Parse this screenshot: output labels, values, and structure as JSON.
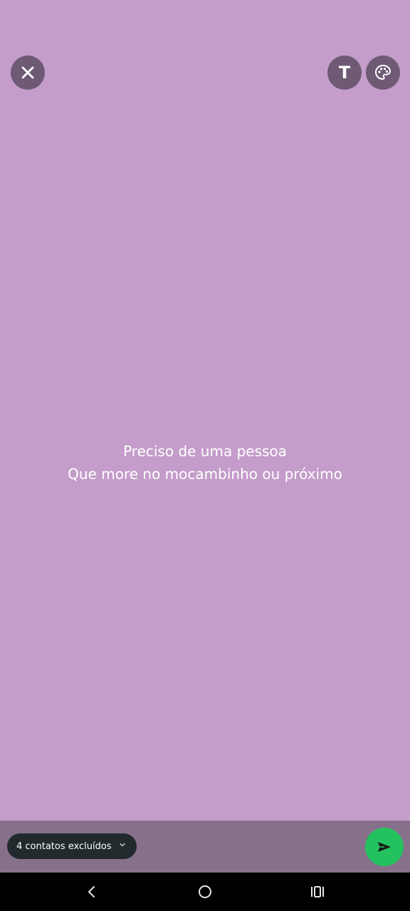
{
  "top_actions": {
    "close_icon": "close-icon",
    "text_style_label": "T",
    "palette_icon": "palette-icon"
  },
  "status": {
    "line1": "Preciso de uma pessoa",
    "line2": "Que more no mocambinho ou próximo"
  },
  "bottom": {
    "audience_label": "4 contatos excluídos",
    "dropdown_icon": "chevron-down-icon",
    "send_icon": "send-icon"
  },
  "nav": {
    "back_icon": "back-icon",
    "home_icon": "home-icon",
    "recents_icon": "recents-icon"
  },
  "colors": {
    "background": "#c49dca",
    "bottom_bar": "#86708a",
    "button": "#6e5a75",
    "send": "#23c25e",
    "pill": "#212a2d"
  }
}
